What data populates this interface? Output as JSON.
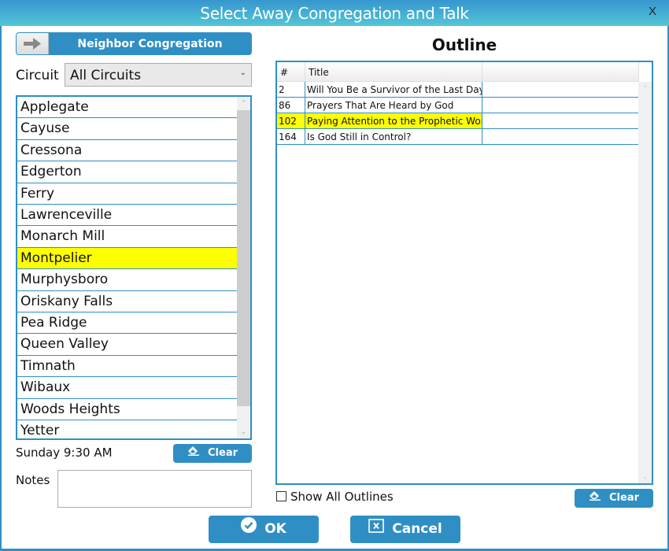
{
  "window": {
    "title": "Select Away Congregation and Talk",
    "close_label": "X"
  },
  "left": {
    "neighbor_button_label": "Neighbor Congregation",
    "circuit_label": "Circuit",
    "circuit_value": "All Circuits",
    "congregations": [
      {
        "name": "Applegate",
        "selected": false
      },
      {
        "name": "Cayuse",
        "selected": false
      },
      {
        "name": "Cressona",
        "selected": false
      },
      {
        "name": "Edgerton",
        "selected": false
      },
      {
        "name": "Ferry",
        "selected": false
      },
      {
        "name": "Lawrenceville",
        "selected": false
      },
      {
        "name": "Monarch Mill",
        "selected": false
      },
      {
        "name": "Montpelier",
        "selected": true
      },
      {
        "name": "Murphysboro",
        "selected": false
      },
      {
        "name": "Oriskany Falls",
        "selected": false
      },
      {
        "name": "Pea Ridge",
        "selected": false
      },
      {
        "name": "Queen Valley",
        "selected": false
      },
      {
        "name": "Timnath",
        "selected": false
      },
      {
        "name": "Wibaux",
        "selected": false
      },
      {
        "name": "Woods Heights",
        "selected": false
      },
      {
        "name": "Yetter",
        "selected": false
      }
    ],
    "meeting_time": "Sunday 9:30 AM",
    "clear_label": "Clear",
    "notes_label": "Notes",
    "notes_value": ""
  },
  "outline": {
    "heading": "Outline",
    "columns": [
      "#",
      "Title",
      ""
    ],
    "rows": [
      {
        "num": "2",
        "title": "Will You Be a Survivor of the Last Days?",
        "selected": false
      },
      {
        "num": "86",
        "title": "Prayers That Are Heard by God",
        "selected": false
      },
      {
        "num": "102",
        "title": "Paying Attention to the Prophetic Word",
        "selected": true
      },
      {
        "num": "164",
        "title": "Is God Still in Control?",
        "selected": false
      }
    ],
    "show_all_label": "Show All Outlines",
    "show_all_checked": false,
    "clear_label": "Clear"
  },
  "footer": {
    "ok_label": "OK",
    "cancel_label": "Cancel"
  },
  "colors": {
    "accent": "#2f8fc4",
    "selection": "#ffff00"
  }
}
